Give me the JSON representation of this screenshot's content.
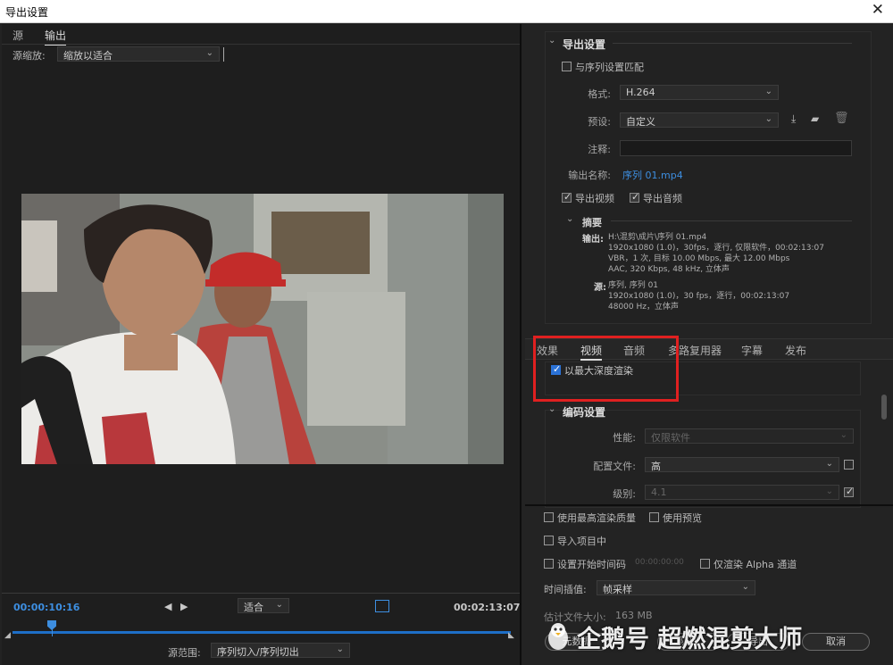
{
  "window": {
    "title": "导出设置",
    "close": "✕"
  },
  "left": {
    "tabs": [
      "源",
      "输出"
    ],
    "scale_label": "源缩放:",
    "scale_value": "缩放以适合",
    "timecode_current": "00:00:10:16",
    "fit_value": "适合",
    "timecode_total": "00:02:13:07",
    "source_range_label": "源范围:",
    "source_range_value": "序列切入/序列切出"
  },
  "export": {
    "section": "导出设置",
    "match_seq": "与序列设置匹配",
    "format_label": "格式:",
    "format_value": "H.264",
    "preset_label": "预设:",
    "preset_value": "自定义",
    "comment_label": "注释:",
    "output_name_label": "输出名称:",
    "output_name_value": "序列 01.mp4",
    "export_video": "导出视频",
    "export_audio": "导出音频",
    "summary_title": "摘要",
    "summary_output_label": "输出:",
    "summary_output_lines": [
      "H:\\混剪\\成片\\序列 01.mp4",
      "1920x1080 (1.0)，30fps，逐行, 仅限软件，00:02:13:07",
      "VBR，1 次, 目标 10.00 Mbps, 最大 12.00 Mbps",
      "AAC, 320 Kbps, 48 kHz, 立体声"
    ],
    "summary_source_label": "源:",
    "summary_source_lines": [
      "序列, 序列 01",
      "1920x1080 (1.0)，30 fps，逐行，00:02:13:07",
      "48000 Hz，立体声"
    ]
  },
  "tabs2": [
    "效果",
    "视频",
    "音频",
    "多路复用器",
    "字幕",
    "发布"
  ],
  "video": {
    "max_depth": "以最大深度渲染",
    "encode_section": "编码设置",
    "perf_label": "性能:",
    "perf_value": "仅限软件",
    "profile_label": "配置文件:",
    "profile_value": "高",
    "level_label": "级别:",
    "level_value": "4.1"
  },
  "bottom": {
    "max_quality": "使用最高渲染质量",
    "use_preview": "使用预览",
    "import_project": "导入项目中",
    "set_start_tc": "设置开始时间码",
    "start_tc_value": "00:00:00:00",
    "alpha_only": "仅渲染 Alpha 通道",
    "interp_label": "时间插值:",
    "interp_value": "帧采样",
    "filesize_label": "估计文件大小:",
    "filesize_value": "163 MB",
    "btn_meta": "元数据",
    "btn_queue": "队列",
    "btn_export": "导出",
    "btn_cancel": "取消",
    "watermark": "企鹅号 超燃混剪大师"
  },
  "colors": {
    "accent": "#2b72d6",
    "highlight": "#e02020",
    "timeline": "#1e6fc8",
    "link": "#3d8ee0"
  }
}
